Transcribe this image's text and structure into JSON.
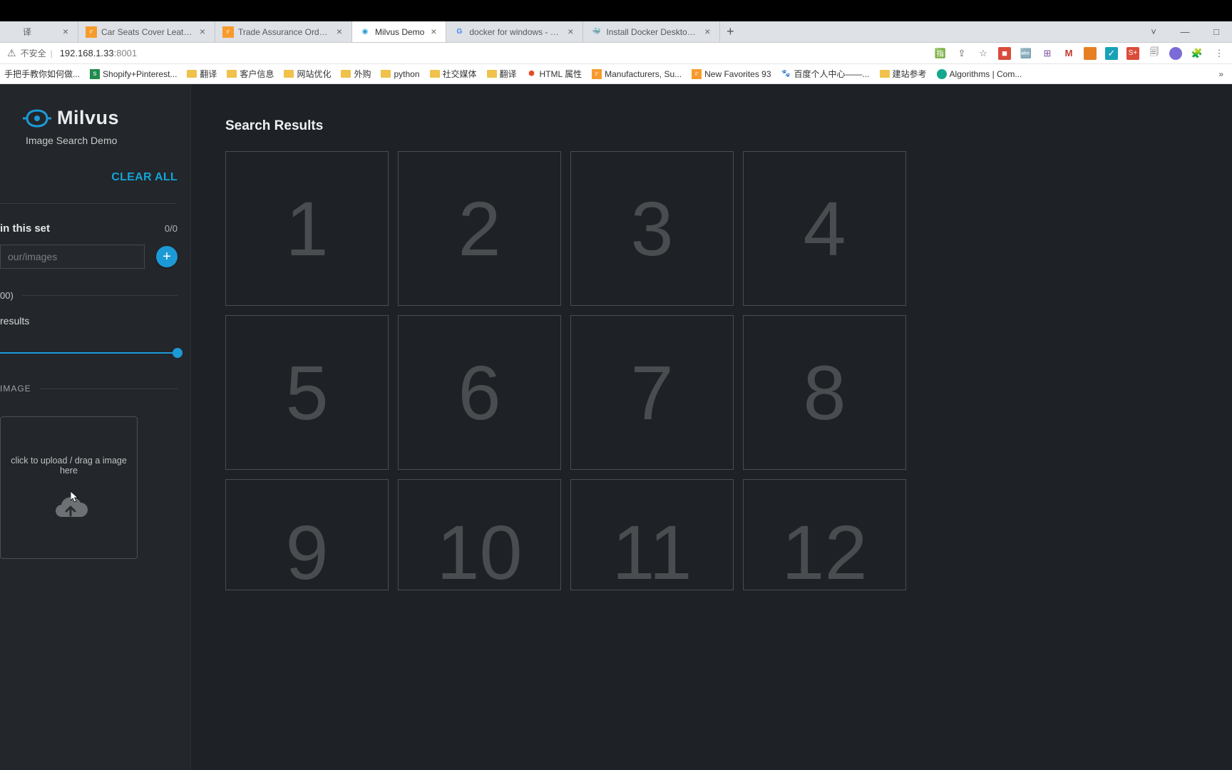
{
  "browser": {
    "tabs": [
      {
        "label": "译",
        "favicon": "",
        "active": false
      },
      {
        "label": "Car Seats Cover Leather Unive",
        "favicon": "ali",
        "active": false
      },
      {
        "label": "Trade Assurance Orders",
        "favicon": "ali",
        "active": false
      },
      {
        "label": "Milvus Demo",
        "favicon": "eye",
        "active": true
      },
      {
        "label": "docker for windows - Google",
        "favicon": "G",
        "active": false
      },
      {
        "label": "Install Docker Desktop on Wi",
        "favicon": "d",
        "active": false
      }
    ],
    "new_tab": "+",
    "window_controls": {
      "dropdown": "˅",
      "min": "—",
      "max": "□"
    },
    "addr": {
      "insecure_label": "不安全",
      "host": "192.168.1.33",
      "port": ":8001"
    },
    "right_icons": [
      "translate",
      "share",
      "star"
    ],
    "extensions": [
      "red",
      "blue",
      "grid",
      "M",
      "or",
      "teal",
      "s+",
      "copy",
      "purple",
      "puzzle",
      "menu"
    ],
    "bookmarks": [
      {
        "label": "手把手教你如何做...",
        "icon": "text"
      },
      {
        "label": "Shopify+Pinterest...",
        "icon": "shop"
      },
      {
        "label": "翻译",
        "icon": "folder"
      },
      {
        "label": "客户信息",
        "icon": "folder"
      },
      {
        "label": "网站优化",
        "icon": "folder"
      },
      {
        "label": "外购",
        "icon": "folder"
      },
      {
        "label": "python",
        "icon": "folder"
      },
      {
        "label": "社交媒体",
        "icon": "folder"
      },
      {
        "label": "翻译",
        "icon": "folder"
      },
      {
        "label": "HTML 属性",
        "icon": "html"
      },
      {
        "label": "Manufacturers, Su...",
        "icon": "ali"
      },
      {
        "label": "New Favorites 93",
        "icon": "ali"
      },
      {
        "label": "百度个人中心——...",
        "icon": "baidu"
      },
      {
        "label": "建站参考",
        "icon": "folder"
      },
      {
        "label": "Algorithms | Com...",
        "icon": "cs"
      }
    ],
    "bookmarks_more": "»"
  },
  "sidebar": {
    "brand": "Milvus",
    "subtitle": "Image Search Demo",
    "clear_all": "CLEAR ALL",
    "set_label": "in this set",
    "set_count": "0/0",
    "set_placeholder": "our/images",
    "add_label": "+",
    "hint00": "00)",
    "results_label": "results",
    "image_section": "IMAGE",
    "upload_hint": "click to upload / drag a image here"
  },
  "main": {
    "title": "Search Results",
    "cells": [
      "1",
      "2",
      "3",
      "4",
      "5",
      "6",
      "7",
      "8",
      "9",
      "10",
      "11",
      "12"
    ]
  }
}
